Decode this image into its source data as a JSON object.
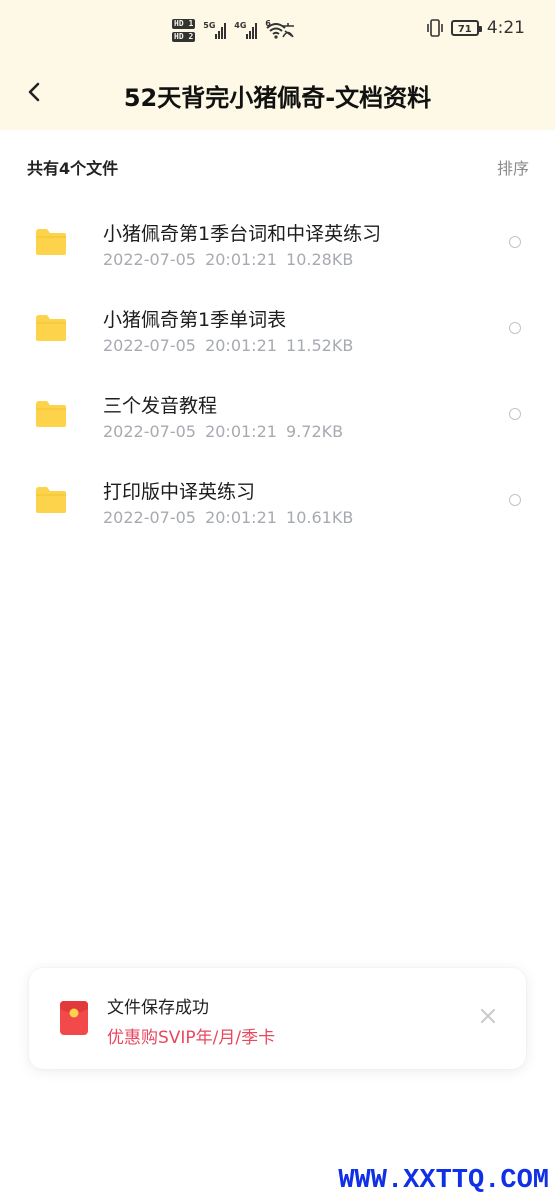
{
  "status_bar": {
    "hd1": "HD 1",
    "hd2": "HD 2",
    "net1": "5G",
    "net2": "4G",
    "wifi_label": "6",
    "battery": "71",
    "time": "4:21",
    "icons": [
      "signal-icon",
      "wifi-icon",
      "vibrate-icon",
      "battery-icon"
    ]
  },
  "header": {
    "title": "52天背完小猪佩奇-文档资料",
    "back_icon": "chevron-left-icon"
  },
  "list_header": {
    "count_text": "共有4个文件",
    "sort_label": "排序"
  },
  "files": [
    {
      "name": "小猪佩奇第1季台词和中译英练习",
      "meta": "2022-07-05 20:01:21 10.28KB"
    },
    {
      "name": "小猪佩奇第1季单词表",
      "meta": "2022-07-05 20:01:21 11.52KB"
    },
    {
      "name": "三个发音教程",
      "meta": "2022-07-05 20:01:21 9.72KB"
    },
    {
      "name": "打印版中译英练习",
      "meta": "2022-07-05 20:01:21 10.61KB"
    }
  ],
  "toast": {
    "title": "文件保存成功",
    "promo": "优惠购SVIP年/月/季卡"
  },
  "watermark": "WWW.XXTTQ.COM",
  "colors": {
    "header_bg": "#fdf9e6",
    "folder": "#fcd34a",
    "promo": "#e8485f",
    "watermark": "#1030e8"
  }
}
